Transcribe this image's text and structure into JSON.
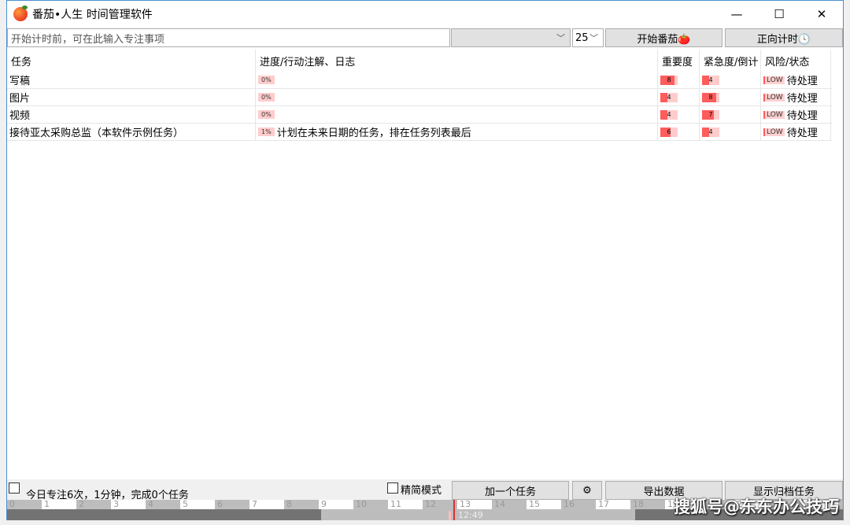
{
  "window": {
    "title": "番茄•人生 时间管理软件",
    "controls": [
      "minimize",
      "maximize",
      "close"
    ]
  },
  "toolbar": {
    "focus_placeholder": "开始计时前，可在此输入专注事项",
    "category_value": "",
    "minutes_value": "25",
    "start_pomodoro": "开始番茄🍅",
    "count_up": "正向计时🕓"
  },
  "table": {
    "headers": [
      "任务",
      "进度/行动注解、日志",
      "重要度",
      "紧急度/倒计",
      "风险/状态"
    ],
    "rows": [
      {
        "task": "写稿",
        "progress": "0%",
        "note": "",
        "importance": 8,
        "urgency": 4,
        "risk": "LOW",
        "status": "待处理"
      },
      {
        "task": "图片",
        "progress": "0%",
        "note": "",
        "importance": 4,
        "urgency": 8,
        "risk": "LOW",
        "status": "待处理"
      },
      {
        "task": "视频",
        "progress": "0%",
        "note": "",
        "importance": 4,
        "urgency": 7,
        "risk": "LOW",
        "status": "待处理"
      },
      {
        "task": "接待亚太采购总监（本软件示例任务）",
        "progress": "1%",
        "note": "计划在未来日期的任务，排在任务列表最后",
        "importance": 6,
        "urgency": 4,
        "risk": "LOW",
        "status": "待处理"
      }
    ]
  },
  "status": {
    "summary": "今日专注6次，1分钟，完成0个任务",
    "compact_mode": "精简模式",
    "add_task": "加一个任务",
    "settings": "⚙",
    "export": "导出数据",
    "show_archived": "显示归档任务"
  },
  "timeline": {
    "hours": [
      "0",
      "1",
      "2",
      "3",
      "4",
      "5",
      "6",
      "7",
      "8",
      "9",
      "10",
      "11",
      "12",
      "13",
      "14",
      "15",
      "16",
      "17",
      "18",
      "19",
      "20",
      "21",
      "22",
      "23"
    ],
    "current_time": "12:49"
  },
  "watermark": "搜狐号@东东办公技巧",
  "colors": {
    "bar_fill": "#ff5c5c",
    "bar_bg": "#ffcccc",
    "now_line": "#e03030"
  }
}
